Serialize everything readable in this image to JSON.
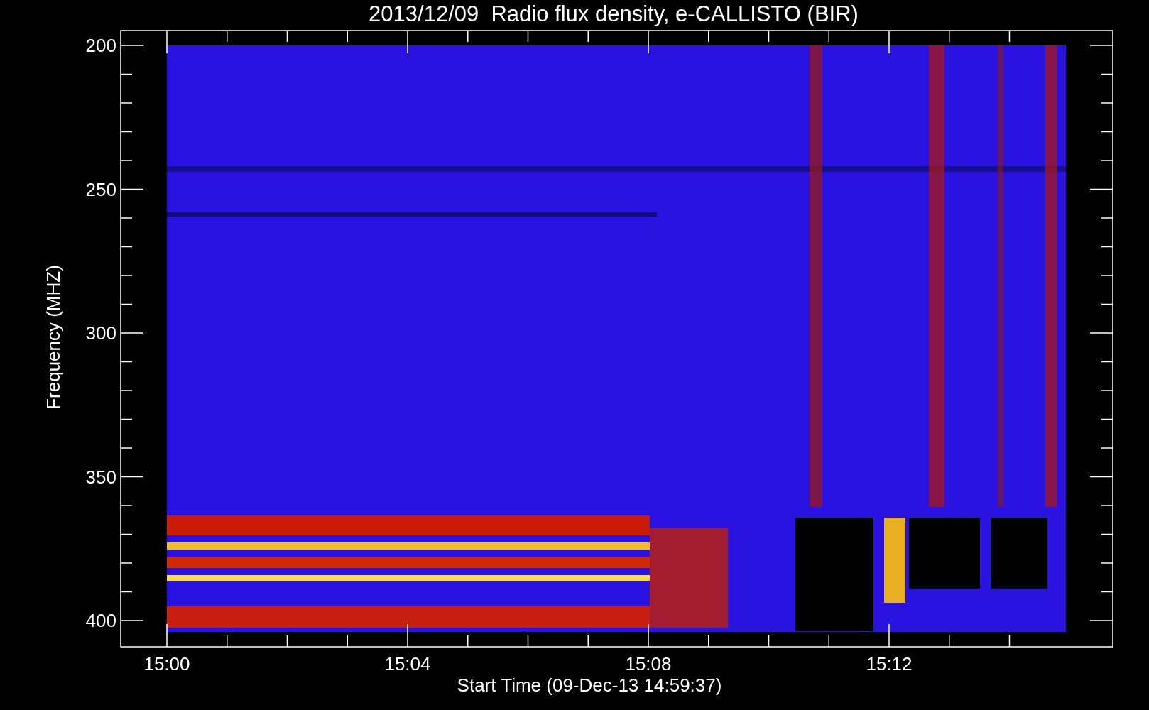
{
  "title": "2013/12/09  Radio flux density, e-CALLISTO (BIR)",
  "ylabel": "Frequency (MHZ)",
  "xlabel": "Start Time (09-Dec-13 14:59:37)",
  "yticks": [
    "200",
    "250",
    "300",
    "350",
    "400"
  ],
  "xticks": [
    "15:00",
    "15:04",
    "15:08",
    "15:12"
  ]
}
